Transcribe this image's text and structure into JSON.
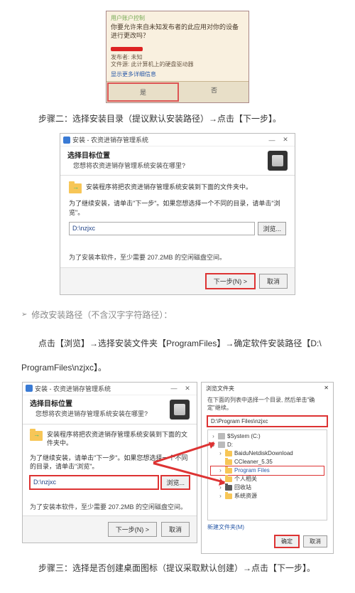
{
  "uac": {
    "titlebar": "用户账户控制",
    "question": "你要允许来自未知发布者的此应用对你的设备进行更改吗？",
    "meta1": "发布者: 未知",
    "meta2": "文件源: 此计算机上的硬盘驱动器",
    "details": "显示更多详细信息",
    "yes": "是",
    "no": "否"
  },
  "cap_step2": "步骤二：选择安装目录（提议默认安装路径）→点击【下一步】。",
  "installer": {
    "title": "安装 - 农资进销存管理系统",
    "hdr_title": "选择目标位置",
    "hdr_sub": "您想将农资进销存管理系统安装在哪里?",
    "folder_line": "安装程序将把农资进销存管理系统安装到下面的文件夹中。",
    "tip": "为了继续安装，请单击\"下一步\"。如果您想选择一个不同的目录，请单击\"浏览\"。",
    "path": "D:\\nzjxc",
    "browse": "浏览...",
    "space": "为了安装本软件，至少需要 207.2MB 的空闲磁盘空间。",
    "next": "下一步(N) >",
    "cancel": "取消"
  },
  "modify_note_label": "修改安装路径（不含汉字字符路径）：",
  "modify_line": "点击【浏览】→选择安装文件夹【ProgramFiles】→确定软件安装路径【D:\\",
  "modify_path_end": "ProgramFiles\\nzjxc】。",
  "folder_dialog": {
    "title": "浏览文件夹",
    "sub": "在下面的列表中选择一个目录, 然后单击\"确定\"继续。",
    "path": "D:\\Program Files\\nzjxc",
    "nodes": {
      "root": "D",
      "sys": "$System (C:)",
      "d": "D:",
      "baidu": "BaiduNetdiskDownload",
      "cc": "CCleaner_5.35",
      "pf": "Program Files",
      "personal": "个人相关",
      "recycle": "回收站",
      "sysres": "系统资源"
    },
    "newfolder": "新建文件夹(M)",
    "ok": "确定",
    "cancel": "取消"
  },
  "cap_step3": "步骤三：选择是否创建桌面图标（提议采取默认创建）→点击【下一步】。"
}
